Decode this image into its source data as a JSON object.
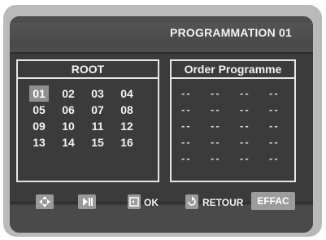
{
  "header": {
    "title": "PROGRAMMATION  01"
  },
  "root_panel": {
    "title": "ROOT",
    "tracks": [
      "01",
      "02",
      "03",
      "04",
      "05",
      "06",
      "07",
      "08",
      "09",
      "10",
      "11",
      "12",
      "13",
      "14",
      "15",
      "16"
    ],
    "selected": "01"
  },
  "order_panel": {
    "title": "Order Programme",
    "slots": [
      "--",
      "--",
      "--",
      "--",
      "--",
      "--",
      "--",
      "--",
      "--",
      "--",
      "--",
      "--",
      "--",
      "--",
      "--",
      "--",
      "--",
      "--",
      "--",
      "--"
    ]
  },
  "footer": {
    "navigate_icon": "four-way-arrow-icon",
    "play_icon": "play-pause-icon",
    "ok_icon": "enter-icon",
    "ok_label": "OK",
    "return_icon": "return-icon",
    "return_label": "RETOUR",
    "clear_label": "EFFAC"
  }
}
